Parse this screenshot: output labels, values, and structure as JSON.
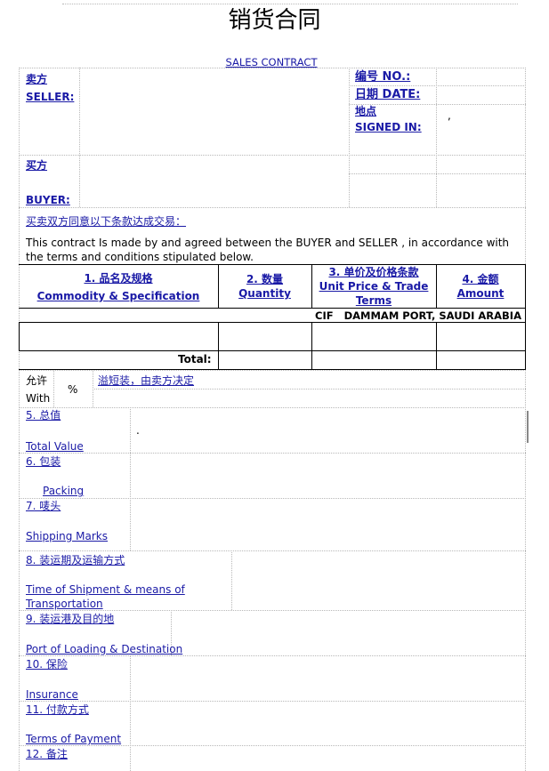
{
  "title": "销货合同",
  "subtitle": "SALES CONTRACT",
  "seller_cn": "卖方",
  "seller_en": "SELLER:",
  "contract_no": "编号 NO.:",
  "date": "日期 DATE:",
  "signed_in_cn": "地点",
  "signed_in_en": "SIGNED IN:",
  "signed_in_value": ",",
  "buyer_cn": "买方",
  "buyer_en": "BUYER:",
  "agreement_cn": "买卖双方同意以下条款达成交易：",
  "agreement_en": "This contract Is made by and agreed between the BUYER and SELLER , in accordance with the terms and conditions stipulated below.",
  "columns": [
    {
      "num": "1. 品名及规格",
      "en": "Commodity & Specification"
    },
    {
      "num": "2. 数量",
      "en": "Quantity"
    },
    {
      "num": "3. 单价及价格条款",
      "en": "Unit Price & Trade",
      "en2": "Terms"
    },
    {
      "num": "4. 金额",
      "en": "Amount"
    }
  ],
  "trade_terms": "CIF   DAMMAM PORT, SAUDI ARABIA",
  "total_label": "Total:",
  "allow_cn": "允许",
  "allow_en": "With",
  "percent": "%",
  "overshort": "溢短装，由卖方决定",
  "sections": {
    "total_value": {
      "cn": "5. 总值",
      "en": "Total Value",
      "value": "."
    },
    "packing": {
      "cn": "6. 包装",
      "en": "Packing"
    },
    "marks": {
      "cn": "7. 唛头",
      "en": "Shipping Marks"
    },
    "shipment": {
      "cn": "8. 装运期及运输方式",
      "en1": "Time of Shipment & means of",
      "en2": "Transportation"
    },
    "loading": {
      "cn": "9. 装运港及目的地",
      "en": "Port of Loading & Destination"
    },
    "insurance": {
      "cn": "10. 保险",
      "en": "Insurance"
    },
    "payment": {
      "cn": "11. 付款方式",
      "en": "Terms of Payment"
    },
    "remarks": {
      "cn": "12. 备注"
    }
  }
}
